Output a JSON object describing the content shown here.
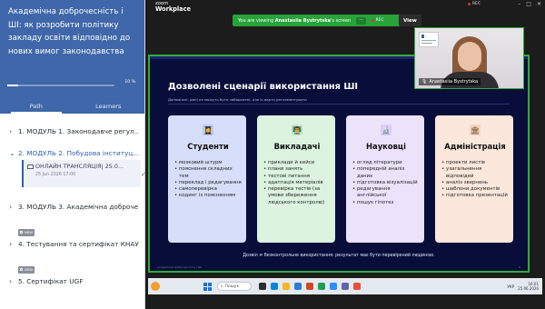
{
  "course": {
    "title": "Академічна доброчесність і ШІ: як розробити політику закладу освіти відповідно до нових вимог законодавства",
    "progress_text": "10 %",
    "progress_fraction": 0.1,
    "tabs": [
      {
        "label": "Path"
      },
      {
        "label": "Learners"
      }
    ],
    "modules": [
      {
        "label": "1. МОДУЛЬ 1. Законодавче регул..."
      },
      {
        "label": "2. МОДУЛЬ 2. Побудова інституц..."
      },
      {
        "label": "3. МОДУЛЬ 3. Академічна доброче..."
      },
      {
        "label": "4. Тестування та сертифікат КНАУ..."
      },
      {
        "label": "5. Сертифікат UGF"
      }
    ],
    "lesson": {
      "title": "ОНЛАЙН ТРАНСЛЯЦІЯ| 25.0...",
      "date": "25 Jun 2026 17:00"
    },
    "badges": [
      "NEW",
      "NEW"
    ]
  },
  "zoom": {
    "logo_top": "zoom",
    "logo_bottom": "Workplace",
    "rec_label": "REC",
    "viewing_prefix": "You are viewing ",
    "viewing_name": "Anastasiia Bystrytska",
    "viewing_suffix": "'s screen",
    "options_label": "⋯",
    "rec_pill": "REC",
    "view_label": "View"
  },
  "slide": {
    "title": "Дозволені сценарії використання ШІ",
    "subtitle": "Допоміжні, дані не можуть бути заборонені, але їх варто регламентувати",
    "cards": [
      {
        "title": "Студенти",
        "icon": "👩‍🎓",
        "items": [
          "мозковий штурм",
          "пояснення складних тем",
          "переклад і редагування",
          "самоперевірка",
          "кодинг із поясненням"
        ]
      },
      {
        "title": "Викладачі",
        "icon": "👨‍🏫",
        "items": [
          "приклади й кейси",
          "плани занять",
          "тестові питання",
          "адаптація матеріалів",
          "перевірка тестів (за умови збереження людського контролю)"
        ]
      },
      {
        "title": "Науковці",
        "icon": "🔬",
        "items": [
          "огляд літератури",
          "попередній аналіз даних",
          "підготовка візуалізацій",
          "редагування англійської",
          "пошук гіпотез"
        ]
      },
      {
        "title": "Адміністрація",
        "icon": "🏛",
        "items": [
          "проекти листів",
          "узагальнення відповідей",
          "аналіз звернень",
          "шаблони документів",
          "підготовка презентацій"
        ]
      }
    ],
    "footnote": "Дозвіл ≠ безконтрольне використання: результат має бути перевірений людиною.",
    "bottom_left": "Академічна доброчесність і ШІ",
    "bottom_right": "8"
  },
  "camera": {
    "name": "Anastasiia Bystrytska"
  },
  "taskbar": {
    "search_placeholder": "Пошук",
    "time": "16:01",
    "date": "25.06.2026",
    "lang": "УКР"
  }
}
